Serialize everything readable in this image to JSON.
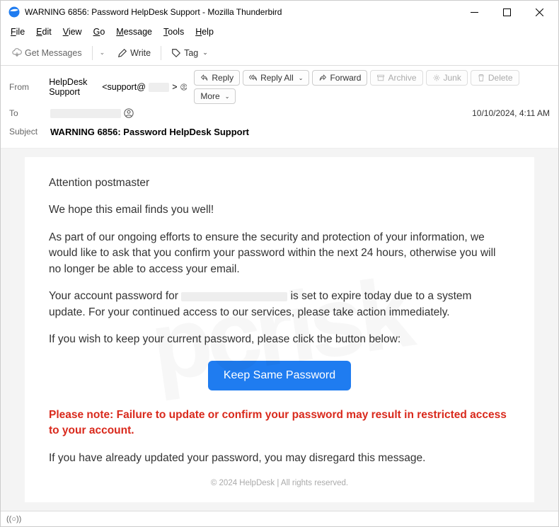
{
  "window": {
    "title": "WARNING 6856: Password HelpDesk Support - Mozilla Thunderbird"
  },
  "menubar": [
    "File",
    "Edit",
    "View",
    "Go",
    "Message",
    "Tools",
    "Help"
  ],
  "toolbar": {
    "get_messages": "Get Messages",
    "write": "Write",
    "tag": "Tag"
  },
  "headers": {
    "from_label": "From",
    "from_name": "HelpDesk Support",
    "from_addr_prefix": "<support@",
    "from_addr_suffix": ">",
    "to_label": "To",
    "subject_label": "Subject",
    "subject": "WARNING 6856: Password HelpDesk Support",
    "timestamp": "10/10/2024, 4:11 AM"
  },
  "actions": {
    "reply": "Reply",
    "reply_all": "Reply All",
    "forward": "Forward",
    "archive": "Archive",
    "junk": "Junk",
    "delete": "Delete",
    "more": "More"
  },
  "body": {
    "greeting": "Attention postmaster",
    "line1": "We hope this email finds you well!",
    "para1": "As part of our ongoing efforts to ensure the security and protection of your information, we would like to ask that you confirm your password within the next 24 hours, otherwise you will no longer be able to access your email.",
    "para2a": "Your account password for ",
    "para2b": " is set to expire today due to a system update. For your continued access to our services, please take action immediately.",
    "para3": "If you wish to keep your current password, please click the button below:",
    "cta": "Keep Same Password",
    "warning": "Please note: Failure to update or confirm your password may result in restricted access to your account.",
    "para4": "If you have already updated your password, you may disregard this message.",
    "footer": "© 2024 HelpDesk | All rights reserved."
  },
  "status": {
    "indicator": "((○))"
  }
}
